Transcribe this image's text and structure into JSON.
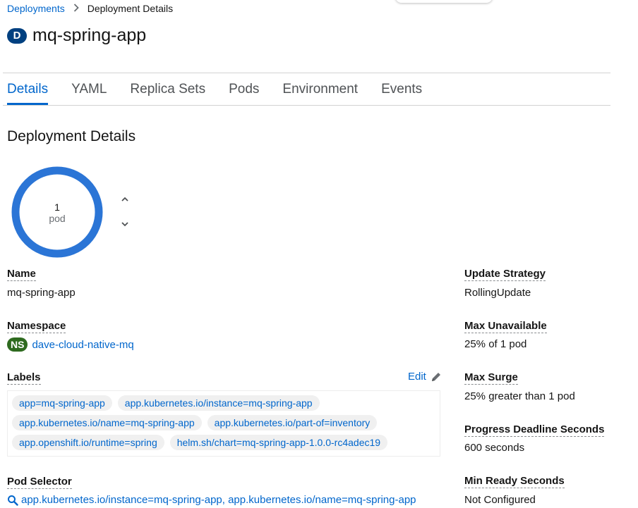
{
  "breadcrumb": {
    "parent": "Deployments",
    "current": "Deployment Details"
  },
  "header": {
    "badge": "D",
    "title": "mq-spring-app"
  },
  "tabs": [
    {
      "label": "Details",
      "active": true
    },
    {
      "label": "YAML",
      "active": false
    },
    {
      "label": "Replica Sets",
      "active": false
    },
    {
      "label": "Pods",
      "active": false
    },
    {
      "label": "Environment",
      "active": false
    },
    {
      "label": "Events",
      "active": false
    }
  ],
  "section_title": "Deployment Details",
  "pod_ring": {
    "count": "1",
    "unit": "pod",
    "ring_color": "#2b75d6"
  },
  "left": {
    "name_label": "Name",
    "name_value": "mq-spring-app",
    "namespace_label": "Namespace",
    "namespace_badge": "NS",
    "namespace_value": "dave-cloud-native-mq",
    "labels_label": "Labels",
    "edit_label": "Edit",
    "label_chips": [
      [
        "app=mq-spring-app",
        "app.kubernetes.io/instance=mq-spring-app"
      ],
      [
        "app.kubernetes.io/name=mq-spring-app",
        "app.kubernetes.io/part-of=inventory"
      ],
      [
        "app.openshift.io/runtime=spring",
        "helm.sh/chart=mq-spring-app-1.0.0-rc4adec19"
      ]
    ],
    "selector_label": "Pod Selector",
    "selector_value": "app.kubernetes.io/instance=mq-spring-app, app.kubernetes.io/name=mq-spring-app"
  },
  "right": {
    "update_strategy_label": "Update Strategy",
    "update_strategy_value": "RollingUpdate",
    "max_unavailable_label": "Max Unavailable",
    "max_unavailable_value": "25% of 1 pod",
    "max_surge_label": "Max Surge",
    "max_surge_value": "25% greater than 1 pod",
    "progress_deadline_label": "Progress Deadline Seconds",
    "progress_deadline_value": "600 seconds",
    "min_ready_label": "Min Ready Seconds",
    "min_ready_value": "Not Configured"
  },
  "colors": {
    "link": "#0066cc",
    "ns_badge": "#2e6a1f",
    "resource_badge": "#004080"
  }
}
